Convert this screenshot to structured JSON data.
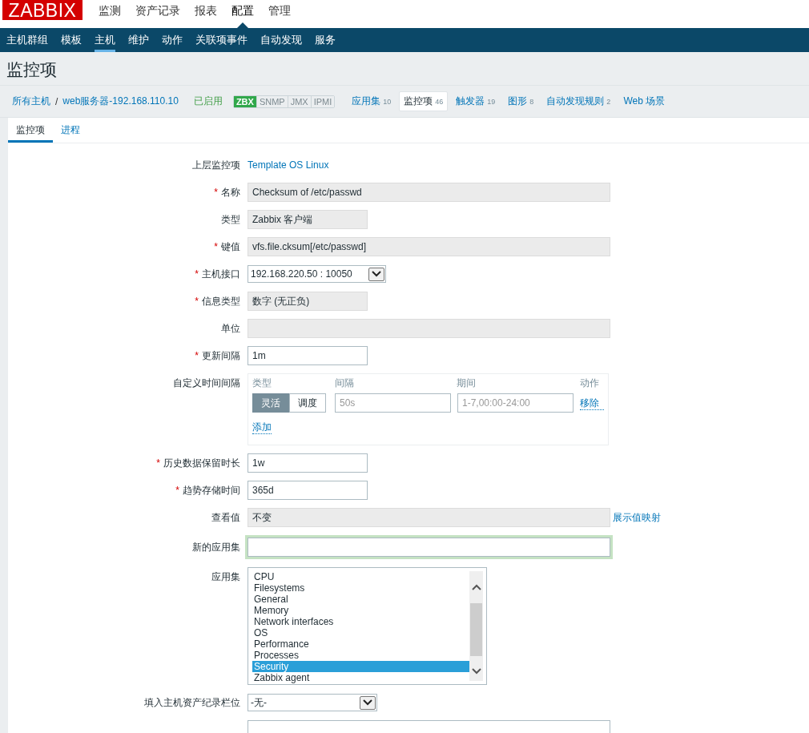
{
  "logo": "ZABBIX",
  "main_menu": [
    {
      "label": "监测",
      "selected": false
    },
    {
      "label": "资产记录",
      "selected": false
    },
    {
      "label": "报表",
      "selected": false
    },
    {
      "label": "配置",
      "selected": true
    },
    {
      "label": "管理",
      "selected": false
    }
  ],
  "sub_menu": [
    {
      "label": "主机群组",
      "selected": false
    },
    {
      "label": "模板",
      "selected": false
    },
    {
      "label": "主机",
      "selected": true
    },
    {
      "label": "维护",
      "selected": false
    },
    {
      "label": "动作",
      "selected": false
    },
    {
      "label": "关联项事件",
      "selected": false
    },
    {
      "label": "自动发现",
      "selected": false
    },
    {
      "label": "服务",
      "selected": false
    }
  ],
  "page_title": "监控项",
  "breadcrumbs": [
    "所有主机",
    "web服务器-192.168.110.10"
  ],
  "breadcrumb_separator": "/",
  "host_status": "已启用",
  "availability": [
    {
      "label": "ZBX",
      "available": true
    },
    {
      "label": "SNMP",
      "available": false
    },
    {
      "label": "JMX",
      "available": false
    },
    {
      "label": "IPMI",
      "available": false
    }
  ],
  "host_tabs": [
    {
      "label": "应用集",
      "count": "10",
      "selected": false
    },
    {
      "label": "监控项",
      "count": "46",
      "selected": true
    },
    {
      "label": "触发器",
      "count": "19",
      "selected": false
    },
    {
      "label": "图形",
      "count": "8",
      "selected": false
    },
    {
      "label": "自动发现规则",
      "count": "2",
      "selected": false
    },
    {
      "label": "Web 场景",
      "selected": false
    }
  ],
  "form_tabs": [
    {
      "label": "监控项",
      "selected": true
    },
    {
      "label": "进程",
      "selected": false
    }
  ],
  "form": [
    {
      "kind": "link",
      "label": "上层监控项",
      "value": "Template OS Linux"
    },
    {
      "kind": "readonly-long",
      "required_mark": "*",
      "label": "名称",
      "value": "Checksum of /etc/passwd"
    },
    {
      "kind": "readonly-short",
      "label": "类型",
      "value": "Zabbix 客户端"
    },
    {
      "kind": "readonly-long",
      "required_mark": "*",
      "label": "键值",
      "value": "vfs.file.cksum[/etc/passwd]"
    },
    {
      "kind": "interface-select",
      "required_mark": "*",
      "label": "主机接口",
      "value": "192.168.220.50 : 10050"
    },
    {
      "kind": "readonly-short",
      "required_mark": "*",
      "label": "信息类型",
      "value": "数字 (无正负)"
    },
    {
      "kind": "readonly-long",
      "label": "单位"
    },
    {
      "kind": "input-short",
      "required_mark": "*",
      "label": "更新间隔",
      "value": "1m",
      "focused": false
    },
    {
      "kind": "intervals",
      "label": "自定义时间间隔",
      "columns": [
        "类型",
        "间隔",
        "期间",
        "动作"
      ],
      "rows": [
        {
          "modes": [
            {
              "label": "灵活",
              "selected": true
            },
            {
              "label": "调度",
              "selected": false
            }
          ],
          "interval_placeholder": "50s",
          "period_placeholder": "1-7,00:00-24:00",
          "action": "移除"
        }
      ],
      "add": "添加"
    },
    {
      "kind": "input-short",
      "required_mark": "*",
      "label": "历史数据保留时长",
      "value": "1w",
      "focused": false
    },
    {
      "kind": "input-short",
      "required_mark": "*",
      "label": "趋势存储时间",
      "value": "365d",
      "focused": false
    },
    {
      "kind": "readonly-long",
      "label": "查看值",
      "value": "不变",
      "link": "展示值映射"
    },
    {
      "kind": "input-long",
      "label": "新的应用集",
      "focused": true
    },
    {
      "kind": "listbox",
      "label": "应用集",
      "items": [
        {
          "label": "CPU",
          "selected": false
        },
        {
          "label": "Filesystems",
          "selected": false
        },
        {
          "label": "General",
          "selected": false
        },
        {
          "label": "Memory",
          "selected": false
        },
        {
          "label": "Network interfaces",
          "selected": false
        },
        {
          "label": "OS",
          "selected": false
        },
        {
          "label": "Performance",
          "selected": false
        },
        {
          "label": "Processes",
          "selected": false
        },
        {
          "label": "Security",
          "selected": true
        },
        {
          "label": "Zabbix agent",
          "selected": false
        }
      ]
    },
    {
      "kind": "inventory-select",
      "label": "填入主机资产纪录栏位",
      "value": "-无-"
    },
    {
      "kind": "textarea"
    }
  ]
}
